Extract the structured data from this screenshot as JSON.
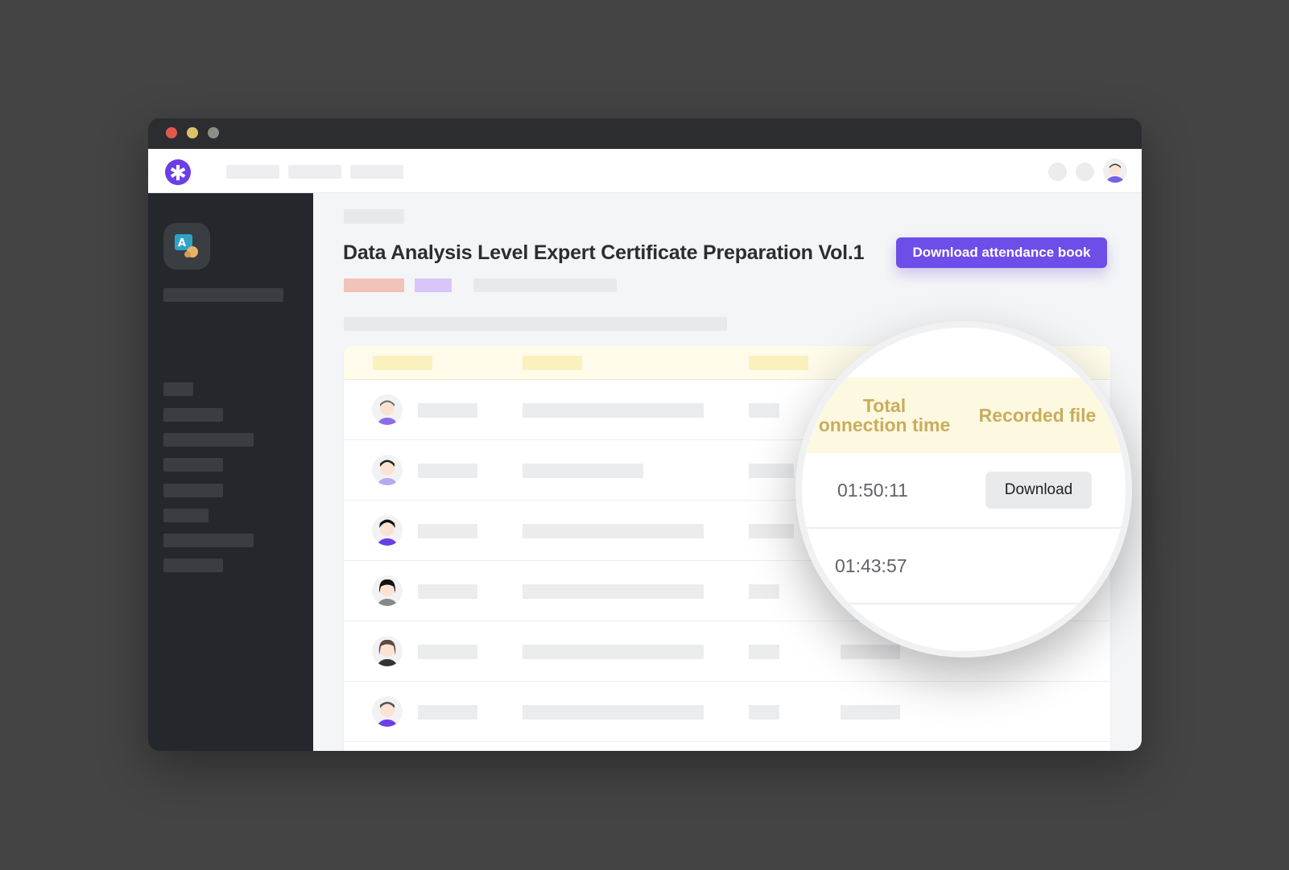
{
  "course": {
    "title": "Data Analysis Level Expert Certificate Preparation Vol.1"
  },
  "actions": {
    "download_attendance_label": "Download attendance book"
  },
  "magnifier": {
    "columns": {
      "total_connection_time_line1": "Total",
      "total_connection_time_line2": "onnection time",
      "recorded_file": "Recorded file"
    },
    "rows": [
      {
        "connection_time": "01:50:11",
        "recorded_file_label": "Download"
      },
      {
        "connection_time": "01:43:57"
      }
    ]
  },
  "logo": {
    "icon": "asterisk-icon",
    "glyph": "✱"
  },
  "colors": {
    "accent": "#6e4ee9",
    "tag_red": "#f2c3b8",
    "tag_purple": "#d8c6f8",
    "header_text": "#c9ad5c"
  }
}
